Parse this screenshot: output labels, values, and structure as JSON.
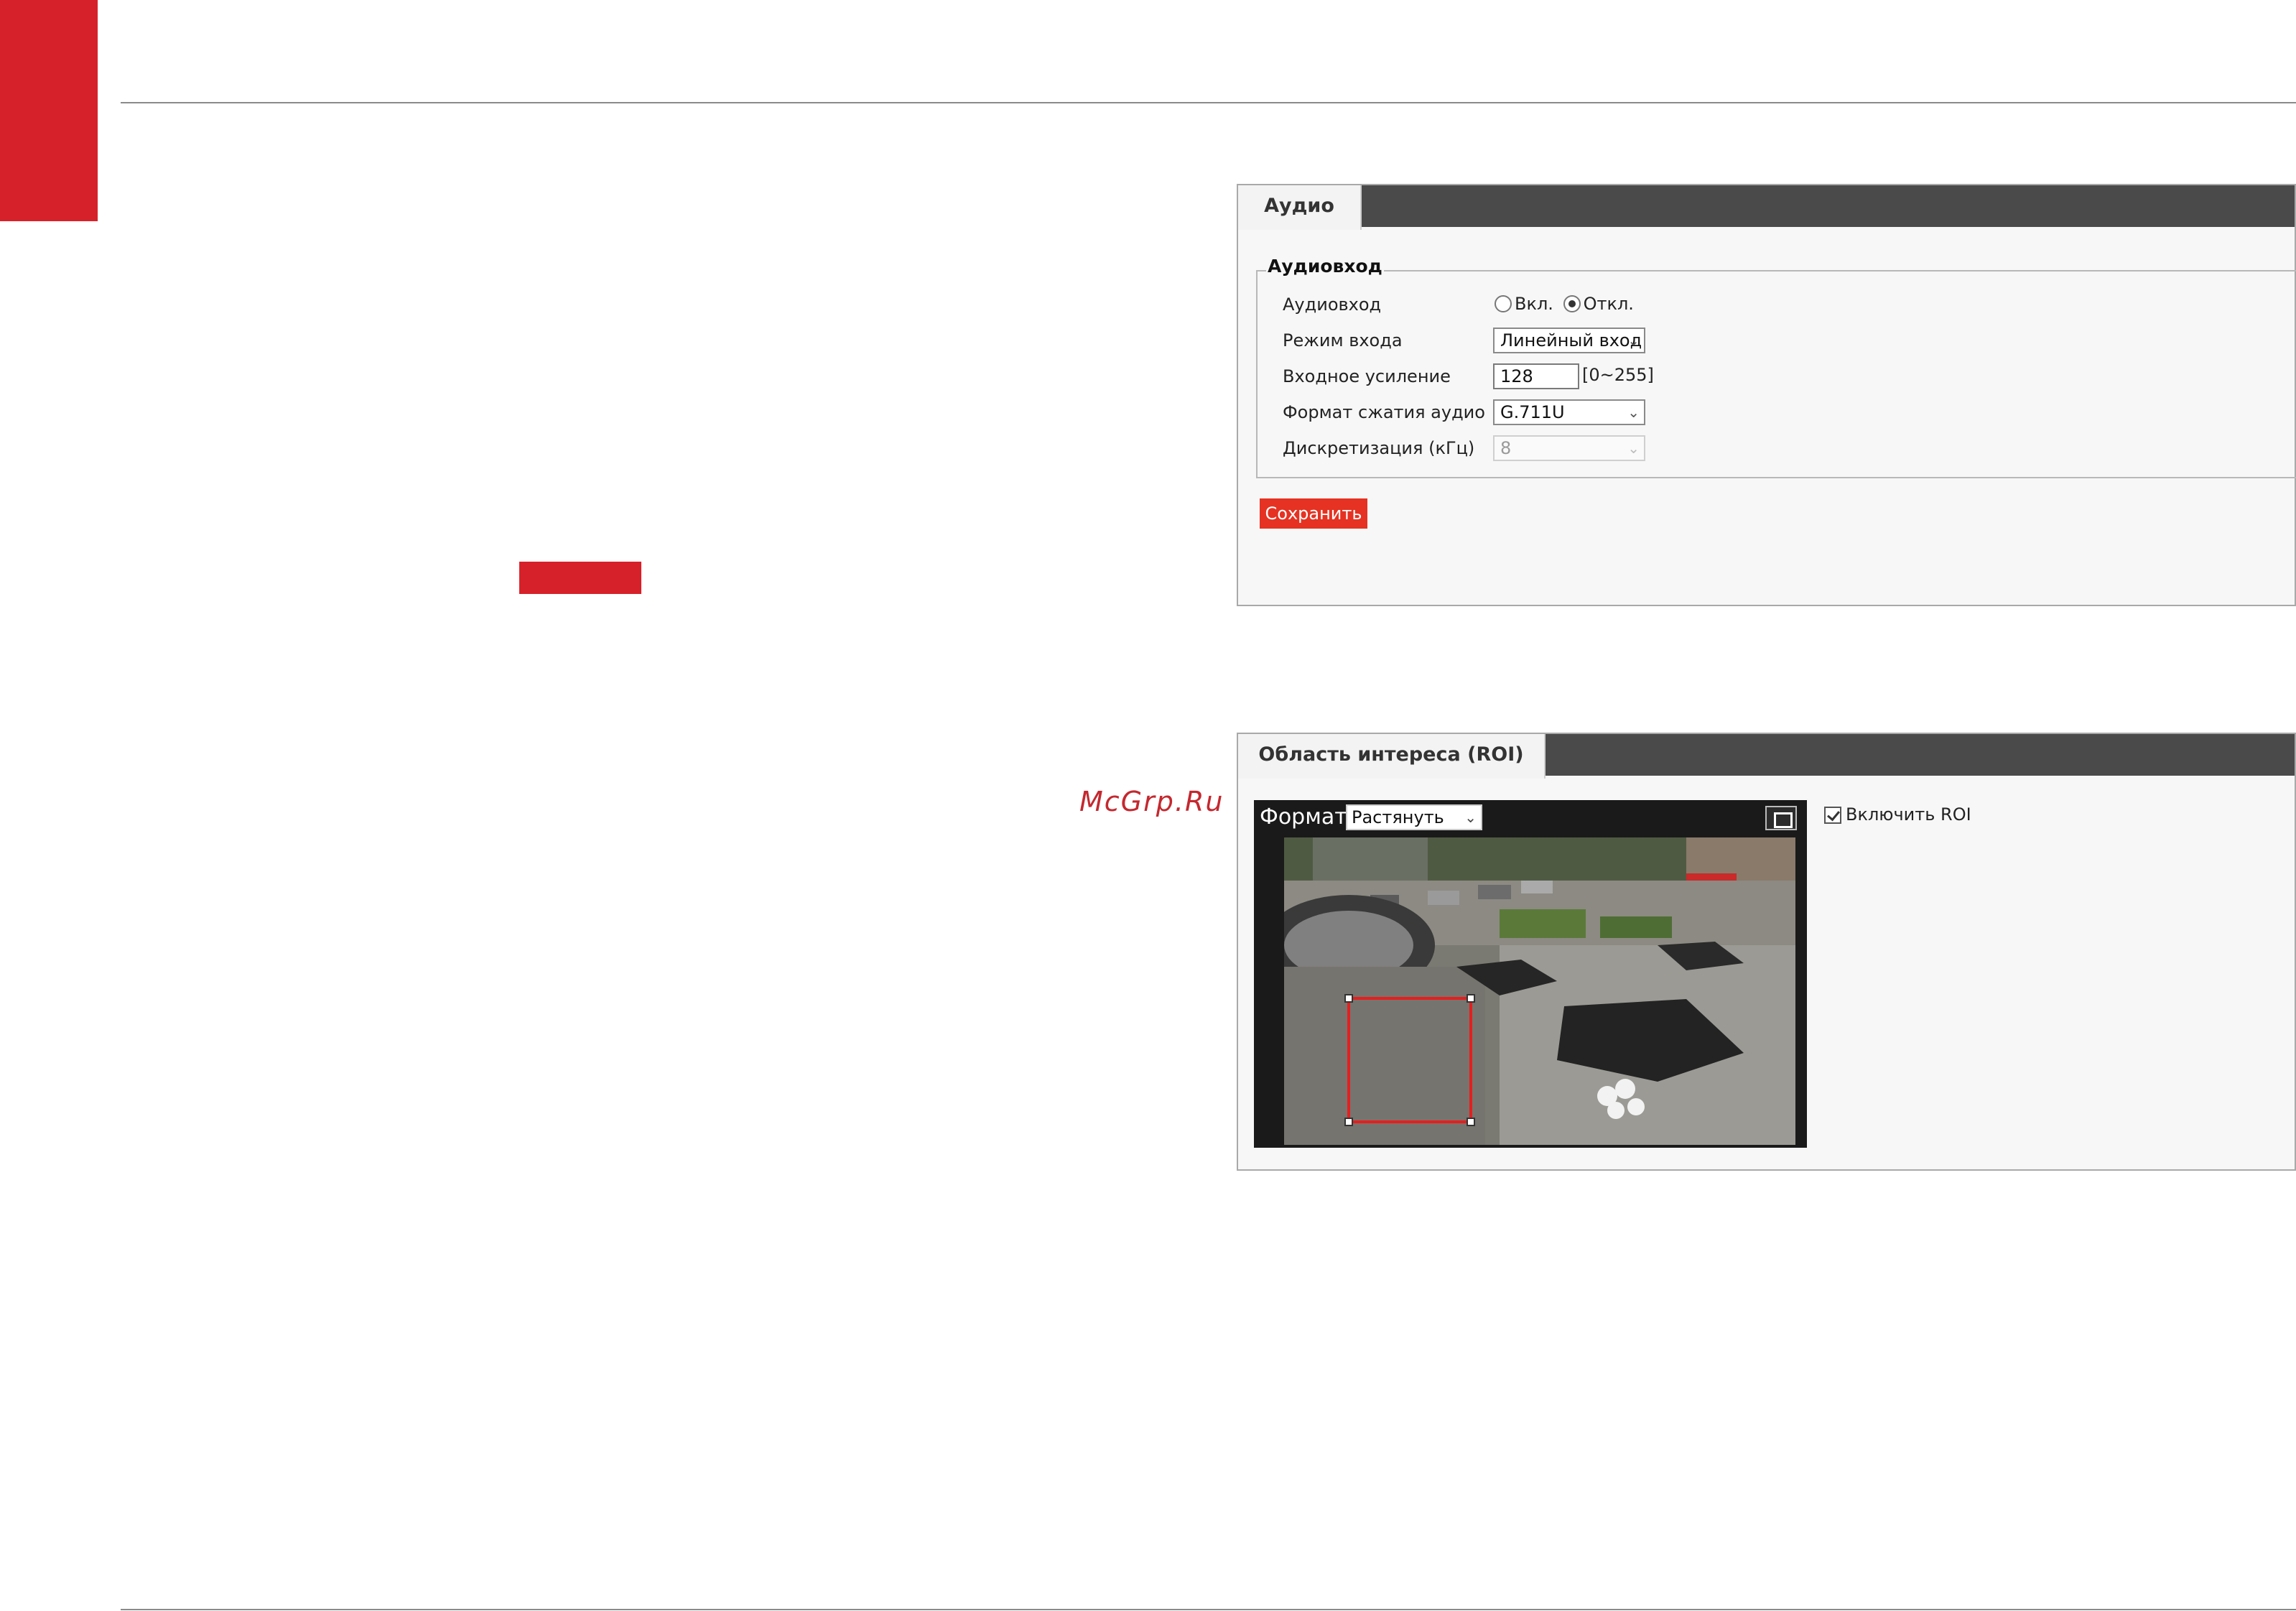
{
  "watermark": "McGrp.Ru",
  "audio_panel": {
    "tab_label": "Аудио",
    "fieldset_title": "Аудиовход",
    "rows": {
      "audio_input": {
        "label": "Аудиовход",
        "options": [
          "Вкл.",
          "Откл."
        ],
        "selected": "Откл."
      },
      "input_mode": {
        "label": "Режим входа",
        "value": "Линейный вход"
      },
      "input_gain": {
        "label": "Входное усиление",
        "value": "128",
        "range": "[0~255]"
      },
      "compression_format": {
        "label": "Формат сжатия аудио",
        "value": "G.711U"
      },
      "sample_rate": {
        "label": "Дискретизация (кГц)",
        "value": "8",
        "disabled": true
      }
    },
    "save_label": "Сохранить"
  },
  "roi_panel": {
    "tab_label": "Область интереса (ROI)",
    "format_label": "Формат:",
    "format_value": "Растянуть",
    "enable_label": "Включить ROI",
    "enable_checked": true
  },
  "colors": {
    "brand_red": "#d7212a",
    "button_red": "#e53222",
    "tabbar_dark": "#4a4a4a",
    "roi_red": "#e61e1e"
  },
  "icons": [
    "radio-off-icon",
    "radio-on-icon",
    "chevron-down-icon",
    "fullscreen-icon",
    "checkbox-checked-icon"
  ]
}
